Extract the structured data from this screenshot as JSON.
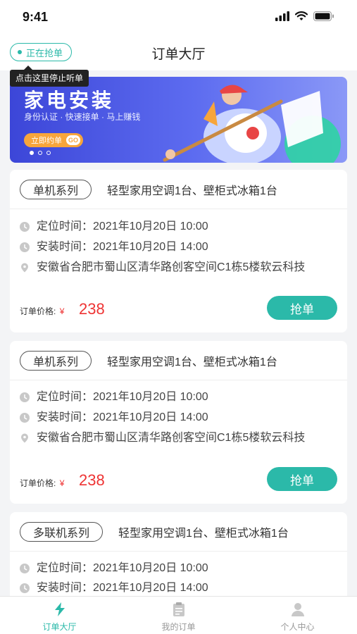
{
  "status_bar": {
    "time": "9:41"
  },
  "header": {
    "title": "订单大厅",
    "grab_status": "正在抢单",
    "tooltip": "点击这里停止听单"
  },
  "banner": {
    "title": "家电安装",
    "subtitle": "身份认证 · 快速接单 · 马上赚钱",
    "button_label": "立即约单",
    "button_go": "GO",
    "slide_count": 3,
    "active_slide": 1
  },
  "orders": [
    {
      "series": "单机系列",
      "description": "轻型家用空调1台、壁柜式冰箱1台",
      "locate_time_label": "定位时间：",
      "locate_time": "2021年10月20日 10:00",
      "install_time_label": "安装时间：",
      "install_time": "2021年10月20日 14:00",
      "address": "安徽省合肥市蜀山区清华路创客空间C1栋5楼软云科技",
      "price_label": "订单价格:",
      "currency": "¥",
      "price": "238",
      "button": "抢单"
    },
    {
      "series": "单机系列",
      "description": "轻型家用空调1台、壁柜式冰箱1台",
      "locate_time_label": "定位时间：",
      "locate_time": "2021年10月20日 10:00",
      "install_time_label": "安装时间：",
      "install_time": "2021年10月20日 14:00",
      "address": "安徽省合肥市蜀山区清华路创客空间C1栋5楼软云科技",
      "price_label": "订单价格:",
      "currency": "¥",
      "price": "238",
      "button": "抢单"
    },
    {
      "series": "多联机系列",
      "description": "轻型家用空调1台、壁柜式冰箱1台",
      "locate_time_label": "定位时间：",
      "locate_time": "2021年10月20日 10:00",
      "install_time_label": "安装时间：",
      "install_time": "2021年10月20日 14:00"
    }
  ],
  "tabbar": [
    {
      "label": "订单大厅",
      "icon": "lightning-icon",
      "active": true
    },
    {
      "label": "我的订单",
      "icon": "clipboard-icon",
      "active": false
    },
    {
      "label": "个人中心",
      "icon": "person-icon",
      "active": false
    }
  ],
  "colors": {
    "accent": "#2bb9a9",
    "price": "#ee3333",
    "banner": "#4b58e6"
  }
}
